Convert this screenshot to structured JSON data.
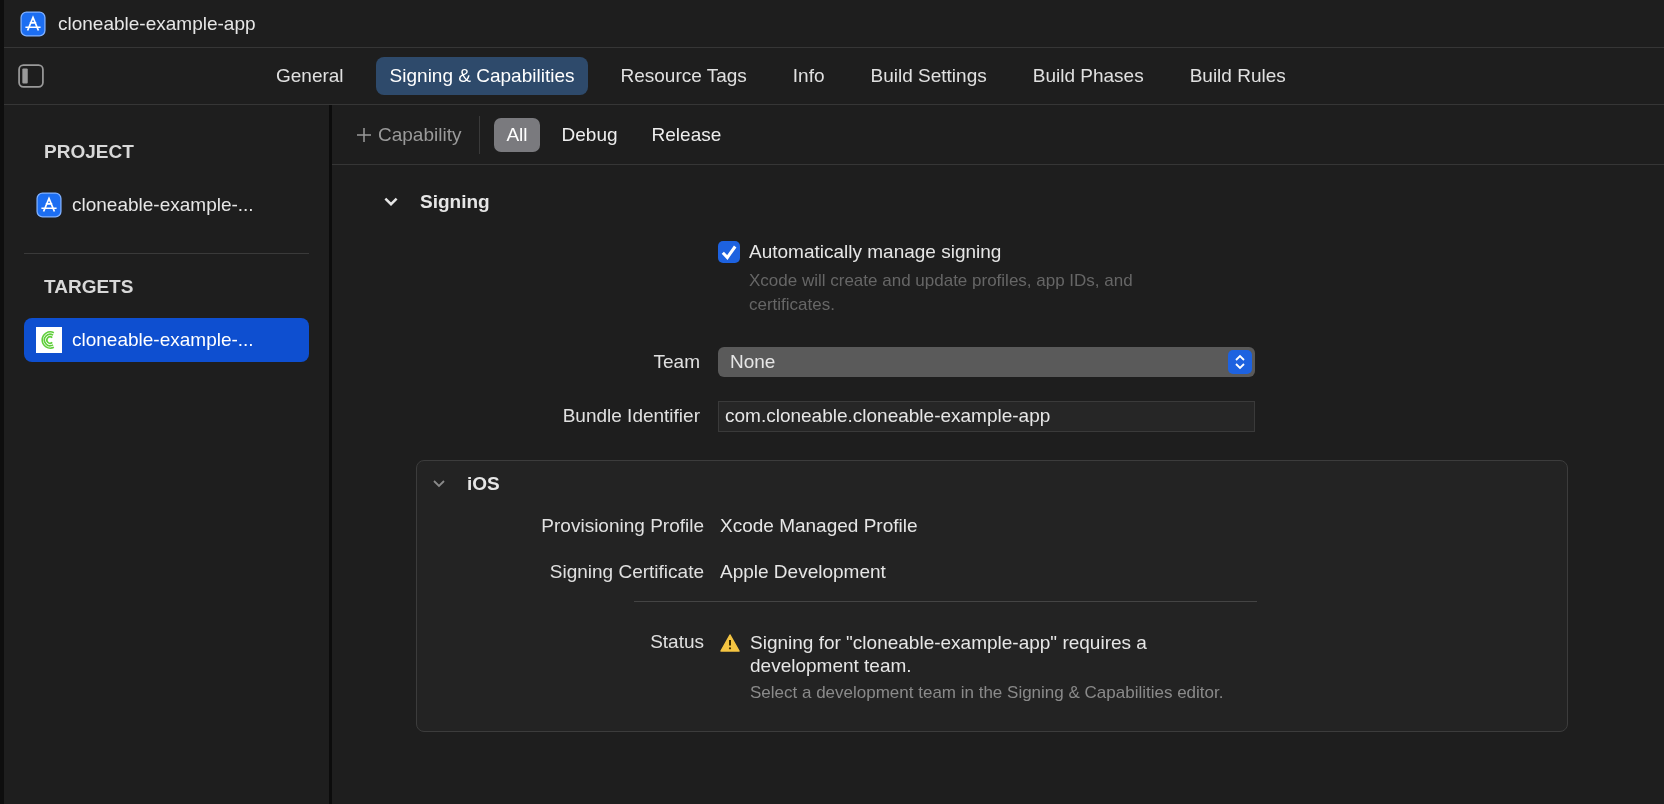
{
  "window": {
    "title": "cloneable-example-app"
  },
  "tabs": [
    {
      "label": "General",
      "selected": false
    },
    {
      "label": "Signing & Capabilities",
      "selected": true
    },
    {
      "label": "Resource Tags",
      "selected": false
    },
    {
      "label": "Info",
      "selected": false
    },
    {
      "label": "Build Settings",
      "selected": false
    },
    {
      "label": "Build Phases",
      "selected": false
    },
    {
      "label": "Build Rules",
      "selected": false
    }
  ],
  "sidebar": {
    "sections": [
      {
        "heading": "PROJECT",
        "items": [
          {
            "label": "cloneable-example-...",
            "kind": "project",
            "selected": false
          }
        ]
      },
      {
        "heading": "TARGETS",
        "items": [
          {
            "label": "cloneable-example-...",
            "kind": "target",
            "selected": true
          }
        ]
      }
    ]
  },
  "filter_bar": {
    "add_label": "Capability",
    "filters": [
      {
        "label": "All",
        "selected": true
      },
      {
        "label": "Debug",
        "selected": false
      },
      {
        "label": "Release",
        "selected": false
      }
    ]
  },
  "signing": {
    "title": "Signing",
    "expanded": true,
    "auto_manage": {
      "label": "Automatically manage signing",
      "checked": true,
      "description": "Xcode will create and update profiles, app IDs, and certificates."
    },
    "team": {
      "label": "Team",
      "value": "None"
    },
    "bundle_identifier": {
      "label": "Bundle Identifier",
      "value": "com.cloneable.cloneable-example-app"
    }
  },
  "ios": {
    "title": "iOS",
    "expanded": true,
    "rows": [
      {
        "label": "Provisioning Profile",
        "value": "Xcode Managed Profile"
      },
      {
        "label": "Signing Certificate",
        "value": "Apple Development"
      }
    ],
    "status": {
      "label": "Status",
      "message": "Signing for \"cloneable-example-app\" requires a development team.",
      "hint": "Select a development team in the Signing & Capabilities editor."
    }
  }
}
